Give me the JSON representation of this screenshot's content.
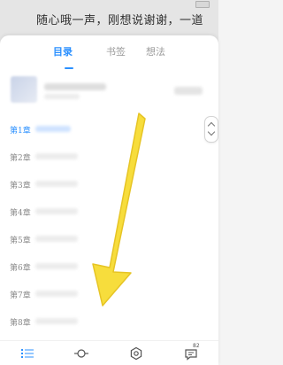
{
  "reader": {
    "text_line": "随心哦一声，刚想说谢谢，一道"
  },
  "panel": {
    "tabs": [
      {
        "label": "目录",
        "active": true
      },
      {
        "label": "书签",
        "active": false
      },
      {
        "label": "想法",
        "active": false
      }
    ],
    "chapters": [
      {
        "label": "第1章",
        "current": true
      },
      {
        "label": "第2章",
        "current": false
      },
      {
        "label": "第3章",
        "current": false
      },
      {
        "label": "第4章",
        "current": false
      },
      {
        "label": "第5章",
        "current": false
      },
      {
        "label": "第6章",
        "current": false
      },
      {
        "label": "第7章",
        "current": false
      },
      {
        "label": "第8章",
        "current": false
      }
    ]
  },
  "bottom_bar": {
    "comment_count": "82"
  },
  "colors": {
    "accent": "#2b90ff",
    "arrow": "#f7dd3c"
  },
  "icons": [
    "list-icon",
    "progress-icon",
    "settings-icon",
    "comment-icon",
    "cursor-arrow-icon",
    "scroll-handle-icon"
  ]
}
